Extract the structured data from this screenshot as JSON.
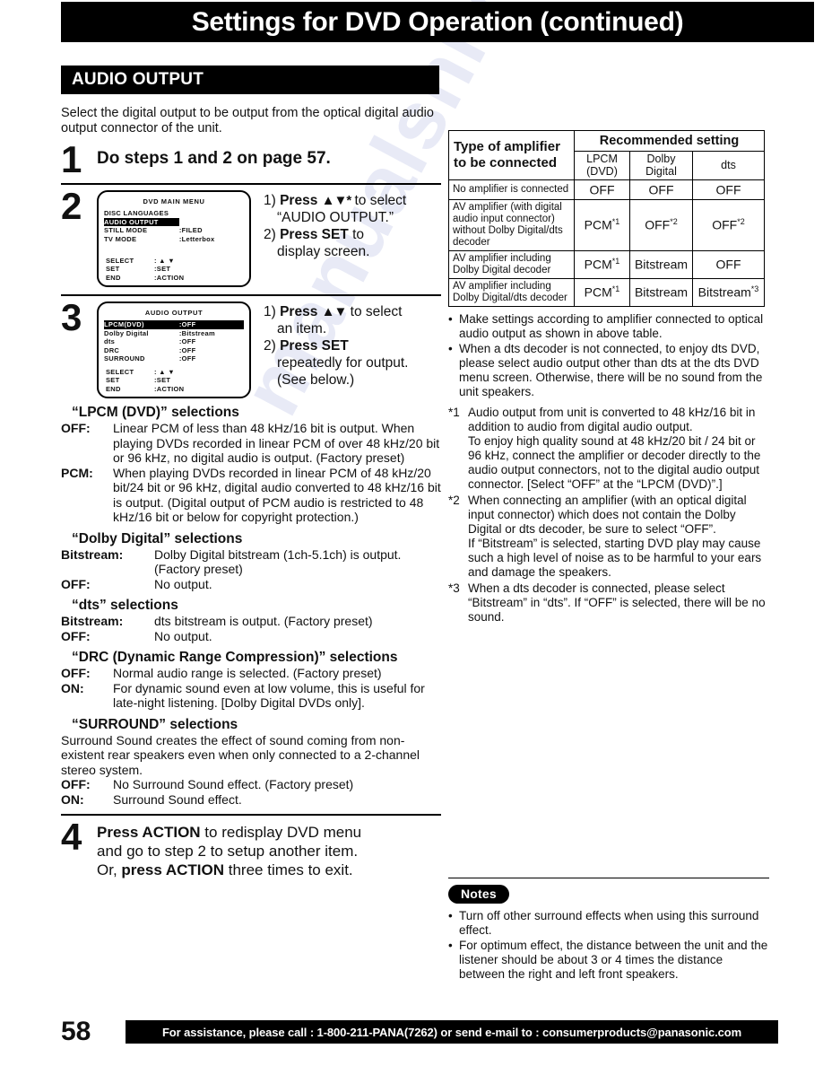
{
  "header": {
    "title": "Settings for DVD Operation (continued)",
    "section": "AUDIO OUTPUT"
  },
  "watermark": "manualshive.com",
  "left": {
    "intro": "Select the digital output to be output from the optical digital audio output connector of the unit.",
    "step1": {
      "num": "1",
      "title": "Do steps 1 and 2 on page 57."
    },
    "step2": {
      "num": "2",
      "osd": {
        "title": "DVD MAIN MENU",
        "rows": [
          {
            "key": "DISC LANGUAGES",
            "value": "",
            "highlight": false
          },
          {
            "key": "AUDIO OUTPUT",
            "value": "",
            "highlight": true
          },
          {
            "key": "STILL MODE",
            "value": ":FILED",
            "highlight": false
          },
          {
            "key": "TV MODE",
            "value": ":Letterbox",
            "highlight": false
          }
        ],
        "footer": [
          {
            "key": "SELECT",
            "value": ": ▲ ▼"
          },
          {
            "key": "SET",
            "value": ":SET"
          },
          {
            "key": "END",
            "value": ":ACTION"
          }
        ]
      },
      "instr": {
        "l1a": "1) ",
        "l1b": "Press ",
        "l1arrows": "▲▼*",
        "l1c": " to select",
        "l2": "“AUDIO OUTPUT.”",
        "l3a": "2) ",
        "l3b": "Press SET",
        "l3c": " to",
        "l4": "display screen."
      }
    },
    "step3": {
      "num": "3",
      "osd": {
        "title": "AUDIO OUTPUT",
        "rows": [
          {
            "key": "LPCM(DVD)",
            "value": ":OFF",
            "highlight": true
          },
          {
            "key": "Dolby Digital",
            "value": ":Bitstream",
            "highlight": false
          },
          {
            "key": "dts",
            "value": ":OFF",
            "highlight": false
          },
          {
            "key": "DRC",
            "value": ":OFF",
            "highlight": false
          },
          {
            "key": "SURROUND",
            "value": ":OFF",
            "highlight": false
          }
        ],
        "footer": [
          {
            "key": "SELECT",
            "value": ": ▲ ▼"
          },
          {
            "key": "SET",
            "value": ":SET"
          },
          {
            "key": "END",
            "value": ":ACTION"
          }
        ]
      },
      "instr": {
        "l1a": "1) ",
        "l1b": "Press ",
        "l1arrows": "▲▼",
        "l1c": " to select",
        "l2": "an item.",
        "l3a": "2) ",
        "l3b": "Press SET",
        "l4": "repeatedly for output.",
        "l5": "(See below.)"
      }
    },
    "selections": [
      {
        "heading": "“LPCM (DVD)” selections",
        "term_width": "w1",
        "items": [
          {
            "term": "OFF:",
            "desc": "Linear PCM of less than 48 kHz/16 bit is output. When playing DVDs recorded in linear PCM of over 48 kHz/20 bit or 96 kHz, no digital audio is output. (Factory preset)"
          },
          {
            "term": "PCM:",
            "desc": "When playing DVDs recorded in linear PCM of 48 kHz/20 bit/24 bit or 96 kHz, digital audio converted to 48 kHz/16 bit is output. (Digital output of PCM audio is restricted to 48 kHz/16 bit or below for copyright protection.)"
          }
        ]
      },
      {
        "heading": "“Dolby Digital” selections",
        "term_width": "w2",
        "items": [
          {
            "term": "Bitstream:",
            "desc": "Dolby Digital bitstream (1ch-5.1ch) is output. (Factory preset)"
          },
          {
            "term": "OFF:",
            "desc": "No output."
          }
        ]
      },
      {
        "heading": "“dts” selections",
        "term_width": "w2",
        "items": [
          {
            "term": "Bitstream:",
            "desc": "dts bitstream is output. (Factory preset)"
          },
          {
            "term": "OFF:",
            "desc": "No output."
          }
        ]
      },
      {
        "heading": "“DRC (Dynamic Range Compression)” selections",
        "term_width": "w1",
        "items": [
          {
            "term": "OFF:",
            "desc": "Normal audio range is selected. (Factory preset)"
          },
          {
            "term": "ON:",
            "desc": "For dynamic sound even at low volume, this is useful for late-night listening. [Dolby Digital DVDs only]."
          }
        ]
      }
    ],
    "surround": {
      "heading": "“SURROUND” selections",
      "para": "Surround Sound creates the effect of sound coming from non-existent rear speakers even when only connected to a 2-channel stereo system.",
      "items": [
        {
          "term": "OFF:",
          "desc": "No Surround Sound effect. (Factory preset)"
        },
        {
          "term": "ON:",
          "desc": "Surround Sound effect."
        }
      ]
    },
    "step4": {
      "num": "4",
      "l1a": "Press ACTION",
      "l1b": " to redisplay DVD menu",
      "l2": "and go to step 2 to setup another item.",
      "l3a": "Or, ",
      "l3b": "press ACTION",
      "l3c": " three times to exit."
    }
  },
  "right": {
    "table": {
      "col0_header": "Type of amplifier to be connected",
      "group_header": "Recommended setting",
      "sub_headers": [
        "LPCM (DVD)",
        "Dolby Digital",
        "dts"
      ],
      "rows": [
        {
          "label": "No amplifier is connected",
          "values": [
            {
              "text": "OFF",
              "fn": ""
            },
            {
              "text": "OFF",
              "fn": ""
            },
            {
              "text": "OFF",
              "fn": ""
            }
          ]
        },
        {
          "label": "AV amplifier (with digital audio input connector) without Dolby Digital/dts decoder",
          "values": [
            {
              "text": "PCM",
              "fn": "*1"
            },
            {
              "text": "OFF",
              "fn": "*2"
            },
            {
              "text": "OFF",
              "fn": "*2"
            }
          ]
        },
        {
          "label": "AV amplifier including Dolby Digital decoder",
          "values": [
            {
              "text": "PCM",
              "fn": "*1"
            },
            {
              "text": "Bitstream",
              "fn": ""
            },
            {
              "text": "OFF",
              "fn": ""
            }
          ]
        },
        {
          "label": "AV amplifier including Dolby Digital/dts decoder",
          "values": [
            {
              "text": "PCM",
              "fn": "*1"
            },
            {
              "text": "Bitstream",
              "fn": ""
            },
            {
              "text": "Bitstream",
              "fn": "*3"
            }
          ]
        }
      ]
    },
    "bullets": [
      "Make settings according to amplifier connected to optical audio output as shown in above table.",
      "When a dts decoder is not connected, to enjoy dts DVD, please select audio output other than dts at the dts DVD menu screen. Otherwise, there will be no sound from the unit speakers."
    ],
    "footnotes": [
      {
        "mark": "*1",
        "text": "Audio output from unit is converted to 48 kHz/16 bit in addition to audio from digital audio output.",
        "sub": "To enjoy high quality sound at 48 kHz/20 bit / 24 bit or 96 kHz, connect the amplifier or decoder directly to the audio output connectors, not to the digital audio output connector. [Select “OFF” at the “LPCM (DVD)”.]"
      },
      {
        "mark": "*2",
        "text": "When connecting an amplifier (with an optical digital input connector) which does not contain the Dolby Digital or dts decoder, be sure to select “OFF”.",
        "sub": "If “Bitstream” is selected, starting DVD play may cause such a high level of noise as to be harmful to your ears and damage the speakers."
      },
      {
        "mark": "*3",
        "text": "When a dts decoder is connected, please select “Bitstream” in “dts”. If “OFF” is selected, there will be no sound.",
        "sub": ""
      }
    ],
    "notes": {
      "label": "Notes",
      "items": [
        "Turn off other surround effects when using this surround effect.",
        "For optimum effect, the distance between the unit and the listener should be about 3 or 4 times the distance between the right and left front speakers."
      ]
    }
  },
  "footer": {
    "page_number": "58",
    "assistance": "For assistance, please call : 1-800-211-PANA(7262) or send e-mail to : consumerproducts@panasonic.com"
  }
}
